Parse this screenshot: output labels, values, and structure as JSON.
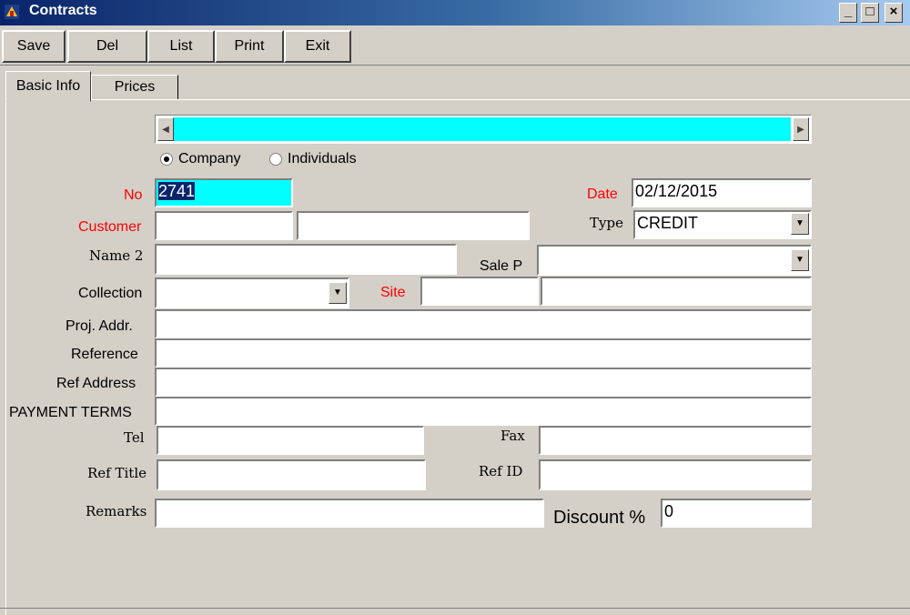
{
  "window": {
    "title": "Contracts",
    "controls": [
      "_",
      "□",
      "×"
    ]
  },
  "toolbar": {
    "save": "Save",
    "del": "Del",
    "list": "List",
    "print": "Print",
    "exit": "Exit"
  },
  "tabs": [
    {
      "label": "Basic Info"
    },
    {
      "label": "Prices"
    }
  ],
  "radio": {
    "company": "Company",
    "individuals": "Individuals",
    "selected": "company"
  },
  "labels": {
    "no": "No",
    "date": "Date",
    "customer": "Customer",
    "type": "Type",
    "name2": "Name 2",
    "sale_p": "Sale P",
    "collection": "Collection",
    "site": "Site",
    "proj_addr": "Proj. Addr.",
    "reference": "Reference",
    "ref_address": "Ref Address",
    "payment_terms": "PAYMENT TERMS",
    "tel": "Tel",
    "fax": "Fax",
    "ref_title": "Ref Title",
    "ref_id": "Ref ID",
    "remarks": "Remarks",
    "discount": "Discount %"
  },
  "values": {
    "no": "2741",
    "date": "02/12/2015",
    "customer_code": "",
    "customer_name": "",
    "type": "CREDIT",
    "name2": "",
    "sale_p": "",
    "collection": "",
    "site_code": "",
    "site_name": "",
    "proj_addr": "",
    "reference": "",
    "ref_address": "",
    "payment_terms": "",
    "tel": "",
    "fax": "",
    "ref_title": "",
    "ref_id": "",
    "remarks": "",
    "discount": "0"
  },
  "icons": {
    "app": "app-icon",
    "down": "chevron-down-icon",
    "left": "scroll-left-icon",
    "right": "scroll-right-icon"
  },
  "colors": {
    "title_start": "#0a246a",
    "highlight": "#00ffff",
    "required_label": "#ff0000"
  }
}
